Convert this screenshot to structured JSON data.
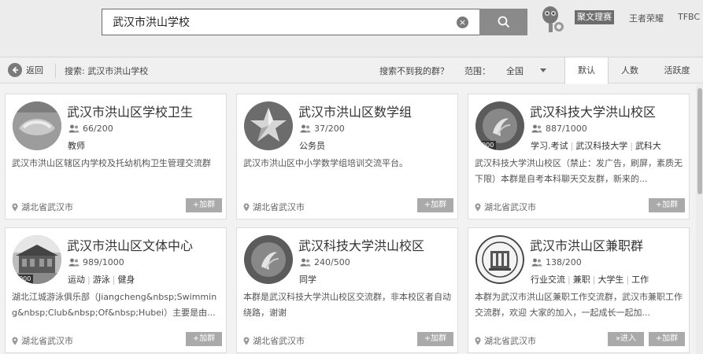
{
  "search": {
    "query": "武汉市洪山学校",
    "clear_symbol": "×"
  },
  "header": {
    "badge": "聚文理赛",
    "links": [
      "王者荣耀",
      "TFBC"
    ]
  },
  "subbar": {
    "back_label": "返回",
    "search_summary": "搜索: 武汉市洪山学校",
    "not_found_label": "搜索不到我的群？",
    "range_label": "范围：",
    "range_value": "全国",
    "sort_tabs": [
      "默认",
      "人数",
      "活跃度"
    ]
  },
  "cards": [
    {
      "title": "武汉市洪山区学校卫生",
      "members": "66/200",
      "tags": [
        "教师"
      ],
      "description": "武汉市洪山区辖区内学校及托幼机构卫生管理交流群",
      "location": "湖北省武汉市",
      "join_label": "+加群",
      "avatar": "avatar-school-health"
    },
    {
      "title": "武汉市洪山区数学组",
      "members": "37/200",
      "tags": [
        "公务员"
      ],
      "description": "武汉市洪山区中小学数学组培训交流平台。",
      "location": "湖北省武汉市",
      "join_label": "+加群",
      "avatar": "avatar-star"
    },
    {
      "title": "武汉科技大学洪山校区",
      "members": "887/1000",
      "tags": [
        "学习.考试",
        "武汉科技大学",
        "武科大"
      ],
      "description": "武汉科技大学洪山校区（禁止：发广告，刷屏，素质无下限）本群是自考本科聊天交友群，新来的...",
      "location": "湖北省武汉市",
      "join_label": "+加群",
      "level": "1000",
      "avatar": "avatar-university"
    },
    {
      "title": "武汉市洪山区文体中心",
      "members": "989/1000",
      "tags": [
        "运动",
        "游泳",
        "健身"
      ],
      "description": "湖北江城游泳俱乐部（Jiangcheng&nbsp;Swimming&nbsp;Club&nbsp;Of&nbsp;Hubei）主要是由...",
      "location": "湖北省武汉市",
      "join_label": "+加群",
      "level": "1000",
      "avatar": "avatar-building"
    },
    {
      "title": "武汉科技大学洪山校区",
      "members": "240/500",
      "tags": [
        "同学"
      ],
      "description": "本群是武汉科技大学洪山校区交流群，非本校区者自动绕路，谢谢",
      "location": "湖北省武汉市",
      "join_label": "+加群",
      "avatar": "avatar-university"
    },
    {
      "title": "武汉市洪山区兼职群",
      "members": "138/200",
      "tags": [
        "行业交流",
        "兼职",
        "大学生",
        "工作"
      ],
      "description": "本群为武汉市洪山区兼职工作交流群，武汉市兼职工作交流群，欢迎 大家的加入，一起成长一起加...",
      "location": "湖北省武汉市",
      "join_label": "+加群",
      "enter_label": "»进入",
      "avatar": "avatar-seal"
    }
  ]
}
